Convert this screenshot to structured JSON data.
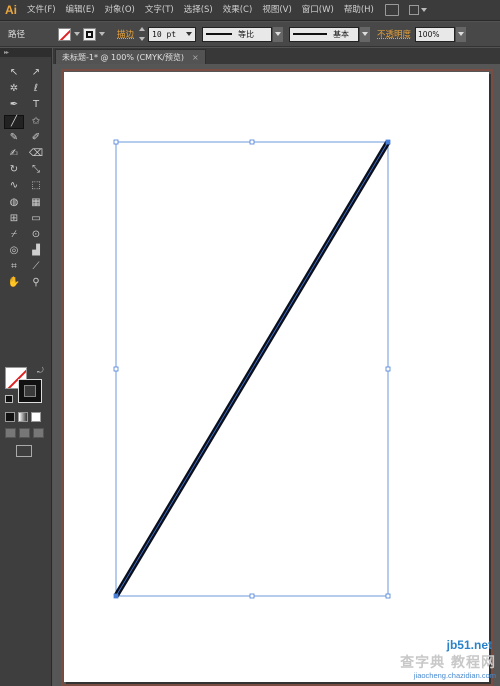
{
  "app": {
    "logo": "Ai"
  },
  "menubar": {
    "items": [
      "文件(F)",
      "编辑(E)",
      "对象(O)",
      "文字(T)",
      "选择(S)",
      "效果(C)",
      "视图(V)",
      "窗口(W)",
      "帮助(H)"
    ]
  },
  "controlbar": {
    "selection_type": "路径",
    "stroke_label": "描边",
    "stroke_weight": "10 pt",
    "variable_width_label": "等比",
    "brush_label": "基本",
    "opacity_label": "不透明度",
    "opacity_value": "100%"
  },
  "toolbox": {
    "tools": [
      {
        "name": "selection-tool-icon",
        "glyph": "↖"
      },
      {
        "name": "direct-selection-tool-icon",
        "glyph": "↗"
      },
      {
        "name": "magic-wand-tool-icon",
        "glyph": "✲"
      },
      {
        "name": "lasso-tool-icon",
        "glyph": "ℓ"
      },
      {
        "name": "pen-tool-icon",
        "glyph": "✒"
      },
      {
        "name": "type-tool-icon",
        "glyph": "T"
      },
      {
        "name": "line-segment-tool-icon",
        "glyph": "╱",
        "active": true
      },
      {
        "name": "star-tool-icon",
        "glyph": "✩"
      },
      {
        "name": "paintbrush-tool-icon",
        "glyph": "✎"
      },
      {
        "name": "pencil-tool-icon",
        "glyph": "✐"
      },
      {
        "name": "blob-brush-tool-icon",
        "glyph": "✍"
      },
      {
        "name": "eraser-tool-icon",
        "glyph": "⌫"
      },
      {
        "name": "rotate-tool-icon",
        "glyph": "↻"
      },
      {
        "name": "scale-tool-icon",
        "glyph": "⤡"
      },
      {
        "name": "warp-tool-icon",
        "glyph": "∿"
      },
      {
        "name": "free-transform-tool-icon",
        "glyph": "⬚"
      },
      {
        "name": "shape-builder-tool-icon",
        "glyph": "◍"
      },
      {
        "name": "perspective-grid-tool-icon",
        "glyph": "▦"
      },
      {
        "name": "mesh-tool-icon",
        "glyph": "⊞"
      },
      {
        "name": "gradient-tool-icon",
        "glyph": "▭"
      },
      {
        "name": "eyedropper-tool-icon",
        "glyph": "⌿"
      },
      {
        "name": "blend-tool-icon",
        "glyph": "⊙"
      },
      {
        "name": "symbol-sprayer-tool-icon",
        "glyph": "◎"
      },
      {
        "name": "column-graph-tool-icon",
        "glyph": "▟"
      },
      {
        "name": "artboard-tool-icon",
        "glyph": "⌗"
      },
      {
        "name": "slice-tool-icon",
        "glyph": "⟋"
      },
      {
        "name": "hand-tool-icon",
        "glyph": "✋"
      },
      {
        "name": "zoom-tool-icon",
        "glyph": "⚲"
      }
    ]
  },
  "document": {
    "tab_title": "未标题-1* @ 100% (CMYK/预览)",
    "close_glyph": "×"
  },
  "artwork": {
    "stroke_color": "#0a0f1e",
    "selection_color": "#4a7fd8"
  },
  "watermark": {
    "site": "jb51.net",
    "cn": "查字典 教程网",
    "sub": "jiaocheng.chazidian.com"
  },
  "colors": {
    "accent_orange": "#e8a23a",
    "menubar_bg": "#3b3b3b",
    "canvas_bg": "#565656"
  }
}
